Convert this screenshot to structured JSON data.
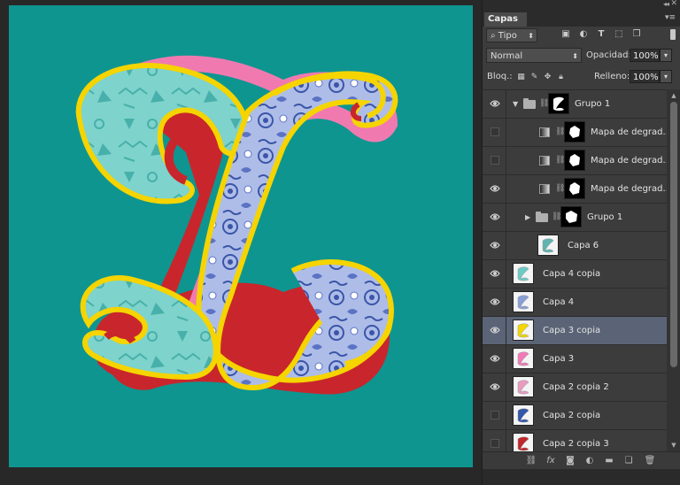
{
  "panel": {
    "collapse_glyph": "◂◂",
    "close_glyph": "✕",
    "tab_label": "Capas",
    "menu_glyph": "▾≡"
  },
  "filter": {
    "kind_label": "Tipo",
    "search_glyph": "⌕"
  },
  "blend": {
    "mode": "Normal",
    "opacity_label": "Opacidad:",
    "opacity_value": "100%",
    "lock_label": "Bloq.:",
    "fill_label": "Relleno:",
    "fill_value": "100%"
  },
  "layers": [
    {
      "name": "Grupo 1",
      "type": "group-open",
      "visible": true,
      "indent": 0,
      "thumb": "mask-z"
    },
    {
      "name": "Mapa de degrad...",
      "type": "adjustment",
      "visible": false,
      "indent": 1
    },
    {
      "name": "Mapa de degrad...",
      "type": "adjustment",
      "visible": false,
      "indent": 1
    },
    {
      "name": "Mapa de degrad...",
      "type": "adjustment",
      "visible": true,
      "indent": 1
    },
    {
      "name": "Grupo 1",
      "type": "group-closed",
      "visible": true,
      "indent": 1
    },
    {
      "name": "Capa 6",
      "type": "pixel",
      "visible": true,
      "indent": 1,
      "color": "#5fb3b0"
    },
    {
      "name": "Capa 4 copia",
      "type": "pixel",
      "visible": true,
      "indent": 0,
      "color": "#6ec9c4"
    },
    {
      "name": "Capa 4",
      "type": "pixel",
      "visible": true,
      "indent": 0,
      "color": "#8a9fd6"
    },
    {
      "name": "Capa 3 copia",
      "type": "pixel",
      "visible": true,
      "indent": 0,
      "color": "#f2d600",
      "selected": true
    },
    {
      "name": "Capa 3",
      "type": "pixel",
      "visible": true,
      "indent": 0,
      "color": "#f07ab8"
    },
    {
      "name": "Capa 2 copia 2",
      "type": "pixel",
      "visible": true,
      "indent": 0,
      "color": "#e89bbf"
    },
    {
      "name": "Capa 2 copia",
      "type": "pixel",
      "visible": false,
      "indent": 0,
      "color": "#3355aa"
    },
    {
      "name": "Capa 2 copia 3",
      "type": "pixel",
      "visible": false,
      "indent": 0,
      "color": "#c0282d"
    }
  ],
  "colors": {
    "canvas_bg": "#0e9590",
    "selected_row": "#5a6476",
    "letter_yellow": "#f5d400",
    "letter_red": "#c8262c",
    "letter_pink": "#f07ab0",
    "letter_teal": "#7ed3cc",
    "letter_blue": "#5b73c4"
  }
}
